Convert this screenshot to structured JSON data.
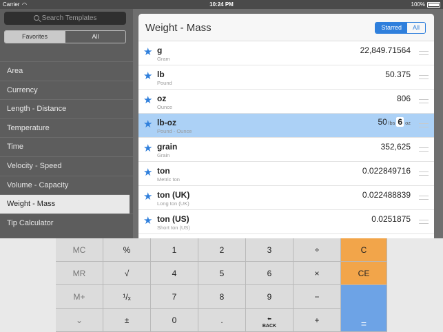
{
  "status": {
    "carrier": "Carrier",
    "wifi": "wifi-icon",
    "time": "10:24 PM",
    "battery": "100%"
  },
  "sidebar": {
    "search_placeholder": "Search Templates",
    "segments": [
      "Favorites",
      "All"
    ],
    "categories": [
      "Area",
      "Currency",
      "Length - Distance",
      "Temperature",
      "Time",
      "Velocity - Speed",
      "Volume - Capacity",
      "Weight - Mass",
      "Tip Calculator"
    ]
  },
  "panel": {
    "title": "Weight - Mass",
    "filters": [
      "Starred",
      "All"
    ],
    "rows": [
      {
        "name": "g",
        "sub": "Gram",
        "value": "22,849.71564"
      },
      {
        "name": "lb",
        "sub": "Pound",
        "value": "50.375"
      },
      {
        "name": "oz",
        "sub": "Ounce",
        "value": "806"
      },
      {
        "name": "lb-oz",
        "sub": "Pound - Ounce",
        "lbs": "50",
        "lbs_unit": "lbs",
        "oz": "6",
        "oz_unit": "oz"
      },
      {
        "name": "grain",
        "sub": "Grain",
        "value": "352,625"
      },
      {
        "name": "ton",
        "sub": "Metric ton",
        "value": "0.022849716"
      },
      {
        "name": "ton (UK)",
        "sub": "Long ton (UK)",
        "value": "0.022488839"
      },
      {
        "name": "ton (US)",
        "sub": "Short ton (US)",
        "value": "0.0251875"
      }
    ]
  },
  "keypad": {
    "mc": "MC",
    "percent": "%",
    "k1": "1",
    "k2": "2",
    "k3": "3",
    "divide": "÷",
    "clear": "C",
    "mr": "MR",
    "sqrt": "√",
    "k4": "4",
    "k5": "5",
    "k6": "6",
    "multiply": "×",
    "clear_entry": "CE",
    "mplus": "M+",
    "reciprocal": "¹/ₓ",
    "k7": "7",
    "k8": "8",
    "k9": "9",
    "minus": "−",
    "hide": "⌄",
    "plusminus": "±",
    "k0": "0",
    "dot": ".",
    "back_label": "BACK",
    "plus": "+",
    "equals": "="
  }
}
